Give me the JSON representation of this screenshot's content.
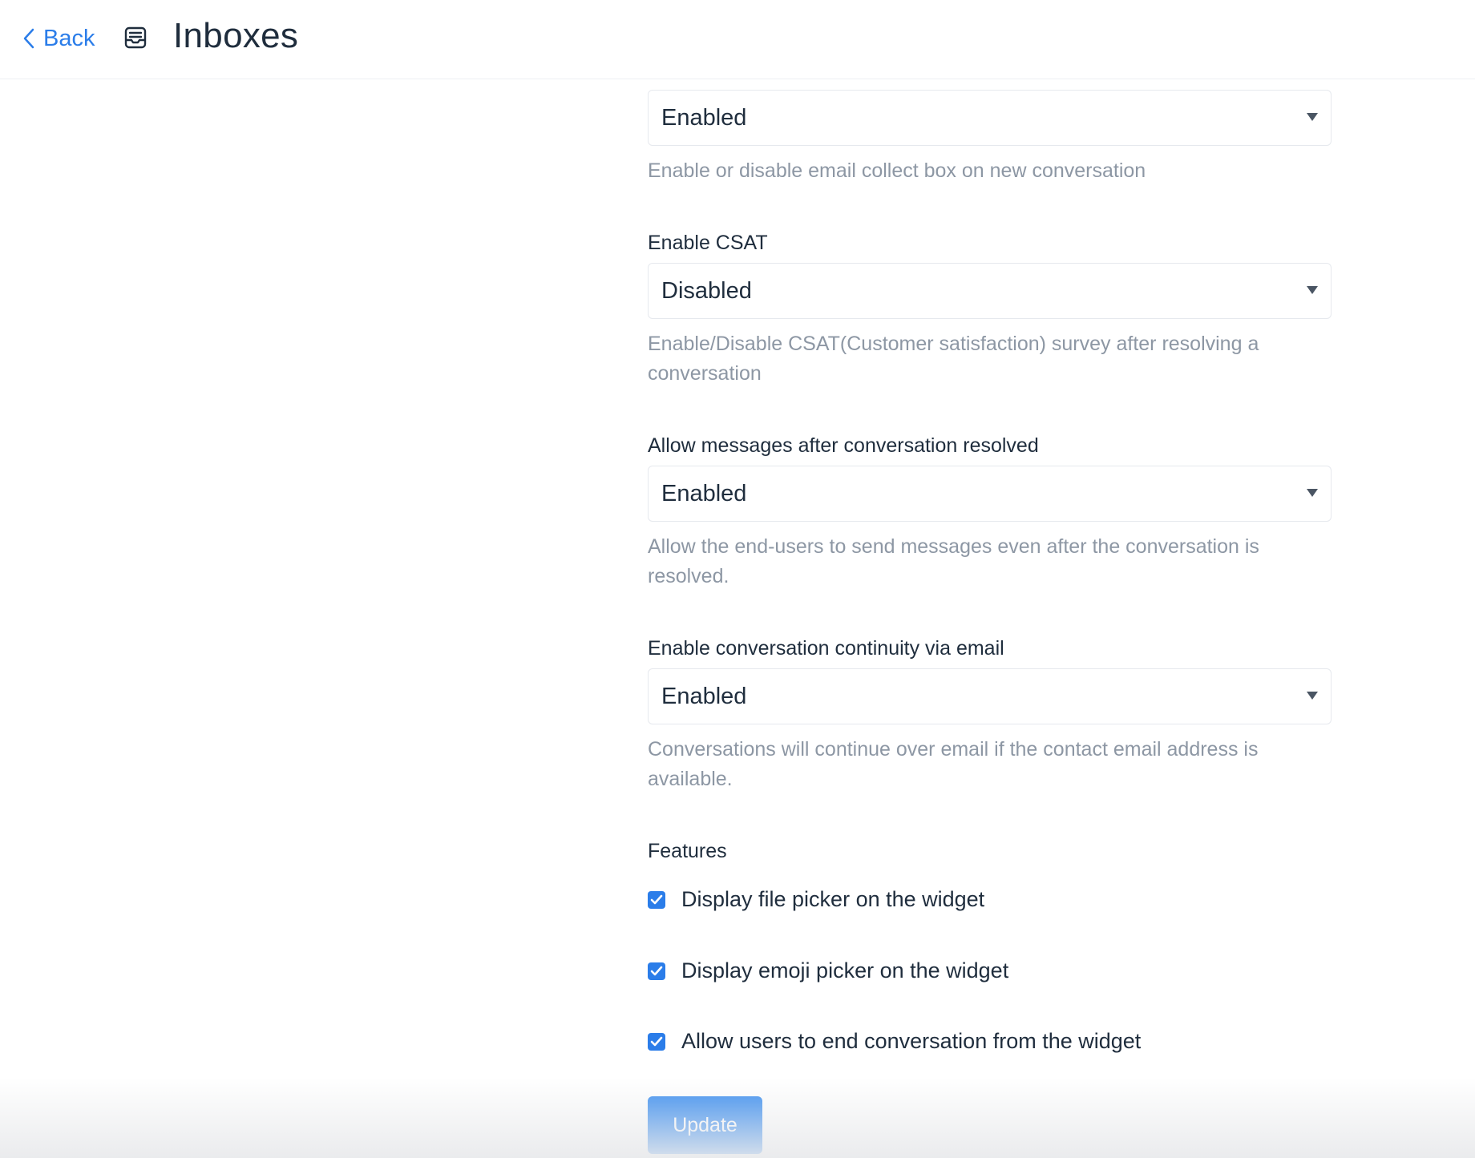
{
  "header": {
    "back_label": "Back",
    "title": "Inboxes",
    "inbox_icon": "inbox-icon",
    "back_icon": "chevron-left-icon"
  },
  "settings": {
    "email_collect": {
      "value": "Enabled",
      "help": "Enable or disable email collect box on new conversation"
    },
    "csat": {
      "label": "Enable CSAT",
      "value": "Disabled",
      "help": "Enable/Disable CSAT(Customer satisfaction) survey after resolving a conversation"
    },
    "allow_messages": {
      "label": "Allow messages after conversation resolved",
      "value": "Enabled",
      "help": "Allow the end-users to send messages even after the conversation is resolved."
    },
    "continuity": {
      "label": "Enable conversation continuity via email",
      "value": "Enabled",
      "help": "Conversations will continue over email if the contact email address is available."
    }
  },
  "features": {
    "label": "Features",
    "items": [
      {
        "label": "Display file picker on the widget",
        "checked": true
      },
      {
        "label": "Display emoji picker on the widget",
        "checked": true
      },
      {
        "label": "Allow users to end conversation from the widget",
        "checked": true
      }
    ]
  },
  "actions": {
    "update_label": "Update"
  },
  "colors": {
    "accent": "#2b7de9",
    "button": "#3b8ef0",
    "help_text": "#8d97a4",
    "text": "#1f2d3d"
  }
}
